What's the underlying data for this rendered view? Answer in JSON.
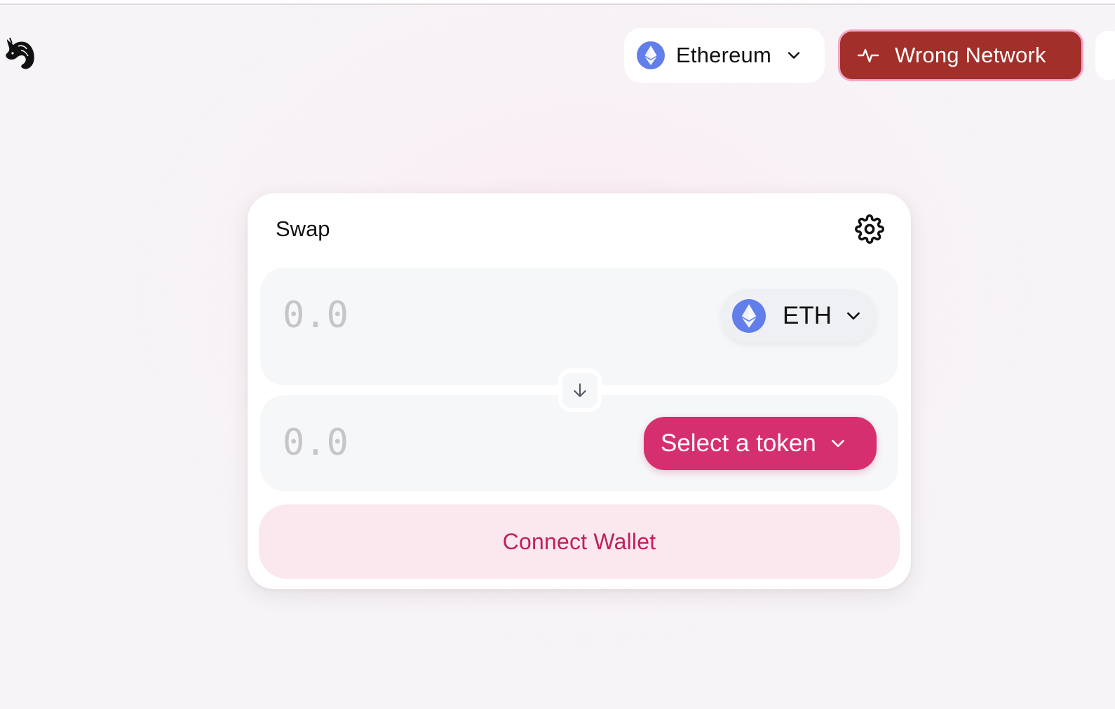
{
  "header": {
    "logo_icon": "uniswap-unicorn-icon",
    "network": {
      "label": "Ethereum",
      "icon": "ethereum-icon",
      "chevron": "chevron-down-icon"
    },
    "wrong_network": {
      "label": "Wrong Network",
      "icon": "pulse-icon"
    }
  },
  "swap": {
    "title": "Swap",
    "settings_icon": "gear-icon",
    "input": {
      "placeholder": "0.0",
      "token_label": "ETH",
      "token_icon": "ethereum-icon"
    },
    "switch_icon": "arrow-down-icon",
    "output": {
      "placeholder": "0.0",
      "select_label": "Select a token"
    },
    "connect_label": "Connect Wallet"
  },
  "colors": {
    "accent_pink": "#d62f6f",
    "wrong_network_red": "#a22f2a",
    "connect_bg": "#fae8ee",
    "connect_text": "#c0205e",
    "ethereum_blue": "#627eea"
  }
}
